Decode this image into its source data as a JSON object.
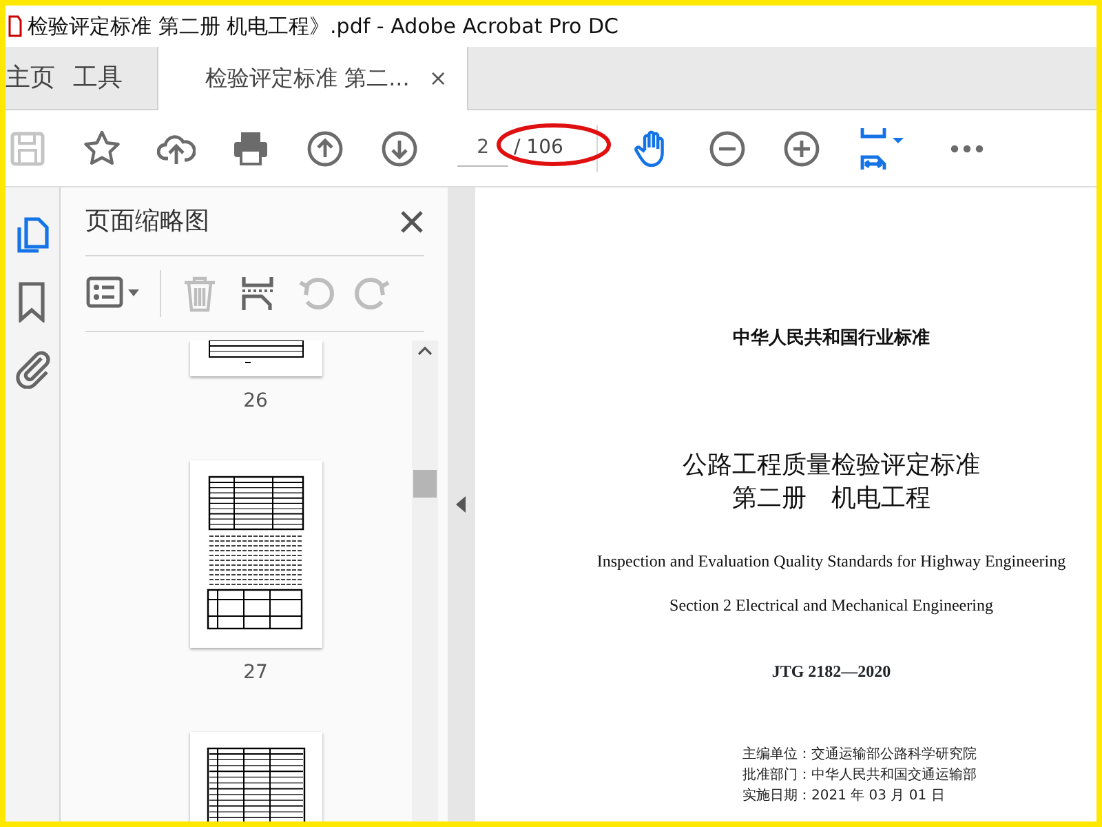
{
  "window": {
    "title": "检验评定标准 第二册 机电工程》.pdf - Adobe Acrobat Pro DC"
  },
  "tabs": [
    {
      "label": "主页",
      "selected": false
    },
    {
      "label": "工具",
      "selected": false
    },
    {
      "label": "检验评定标准 第二...",
      "selected": true,
      "close": "×"
    }
  ],
  "toolbar": {
    "tools": [
      {
        "kind": "save",
        "disabled": true,
        "selected": false
      },
      {
        "kind": "star",
        "disabled": false,
        "selected": false
      },
      {
        "kind": "upload",
        "disabled": false,
        "selected": false
      },
      {
        "kind": "print",
        "disabled": false,
        "selected": false
      },
      {
        "kind": "page-up",
        "disabled": false,
        "selected": false
      },
      {
        "kind": "page-down",
        "disabled": false,
        "selected": false
      },
      {
        "kind": "page-field",
        "value": "2",
        "total": "/ 106"
      },
      {
        "kind": "hand",
        "disabled": false,
        "selected": true
      },
      {
        "kind": "zoom-out",
        "disabled": false,
        "selected": false
      },
      {
        "kind": "zoom-in",
        "disabled": false,
        "selected": false
      },
      {
        "kind": "fit"
      },
      {
        "kind": "more",
        "disabled": false,
        "selected": false
      }
    ]
  },
  "sidebar": {
    "items": [
      {
        "kind": "pages",
        "selected": true
      },
      {
        "kind": "bookmarks",
        "selected": false
      },
      {
        "kind": "attachments",
        "selected": false
      }
    ]
  },
  "thumbnails_panel": {
    "title": "页面缩略图",
    "tools": [
      {
        "kind": "options",
        "disabled": false
      },
      {
        "kind": "delete",
        "disabled": true
      },
      {
        "kind": "insert",
        "disabled": false
      },
      {
        "kind": "rotate-left",
        "disabled": true
      },
      {
        "kind": "rotate-right",
        "disabled": true
      }
    ],
    "pages": [
      {
        "label": "26",
        "kind": "tail"
      },
      {
        "label": "27",
        "kind": "full"
      },
      {
        "kind": "head"
      }
    ]
  },
  "document": {
    "lines": [
      {
        "kind": "header",
        "text": "中华人民共和国行业标准"
      },
      {
        "kind": "title",
        "text": "公路工程质量检验评定标准"
      },
      {
        "kind": "title",
        "text": "第二册　机电工程"
      },
      {
        "kind": "english",
        "text": "Inspection and Evaluation Quality Standards for Highway Engineering"
      },
      {
        "kind": "english",
        "text": "Section 2   Electrical and Mechanical Engineering"
      },
      {
        "kind": "code",
        "text": "JTG 2182—2020"
      },
      {
        "kind": "meta",
        "text": "主编单位：交通运输部公路科学研究院"
      },
      {
        "kind": "meta",
        "text": "批准部门：中华人民共和国交通运输部"
      },
      {
        "kind": "meta",
        "text": "实施日期：2021 年 03 月 01 日"
      }
    ]
  }
}
